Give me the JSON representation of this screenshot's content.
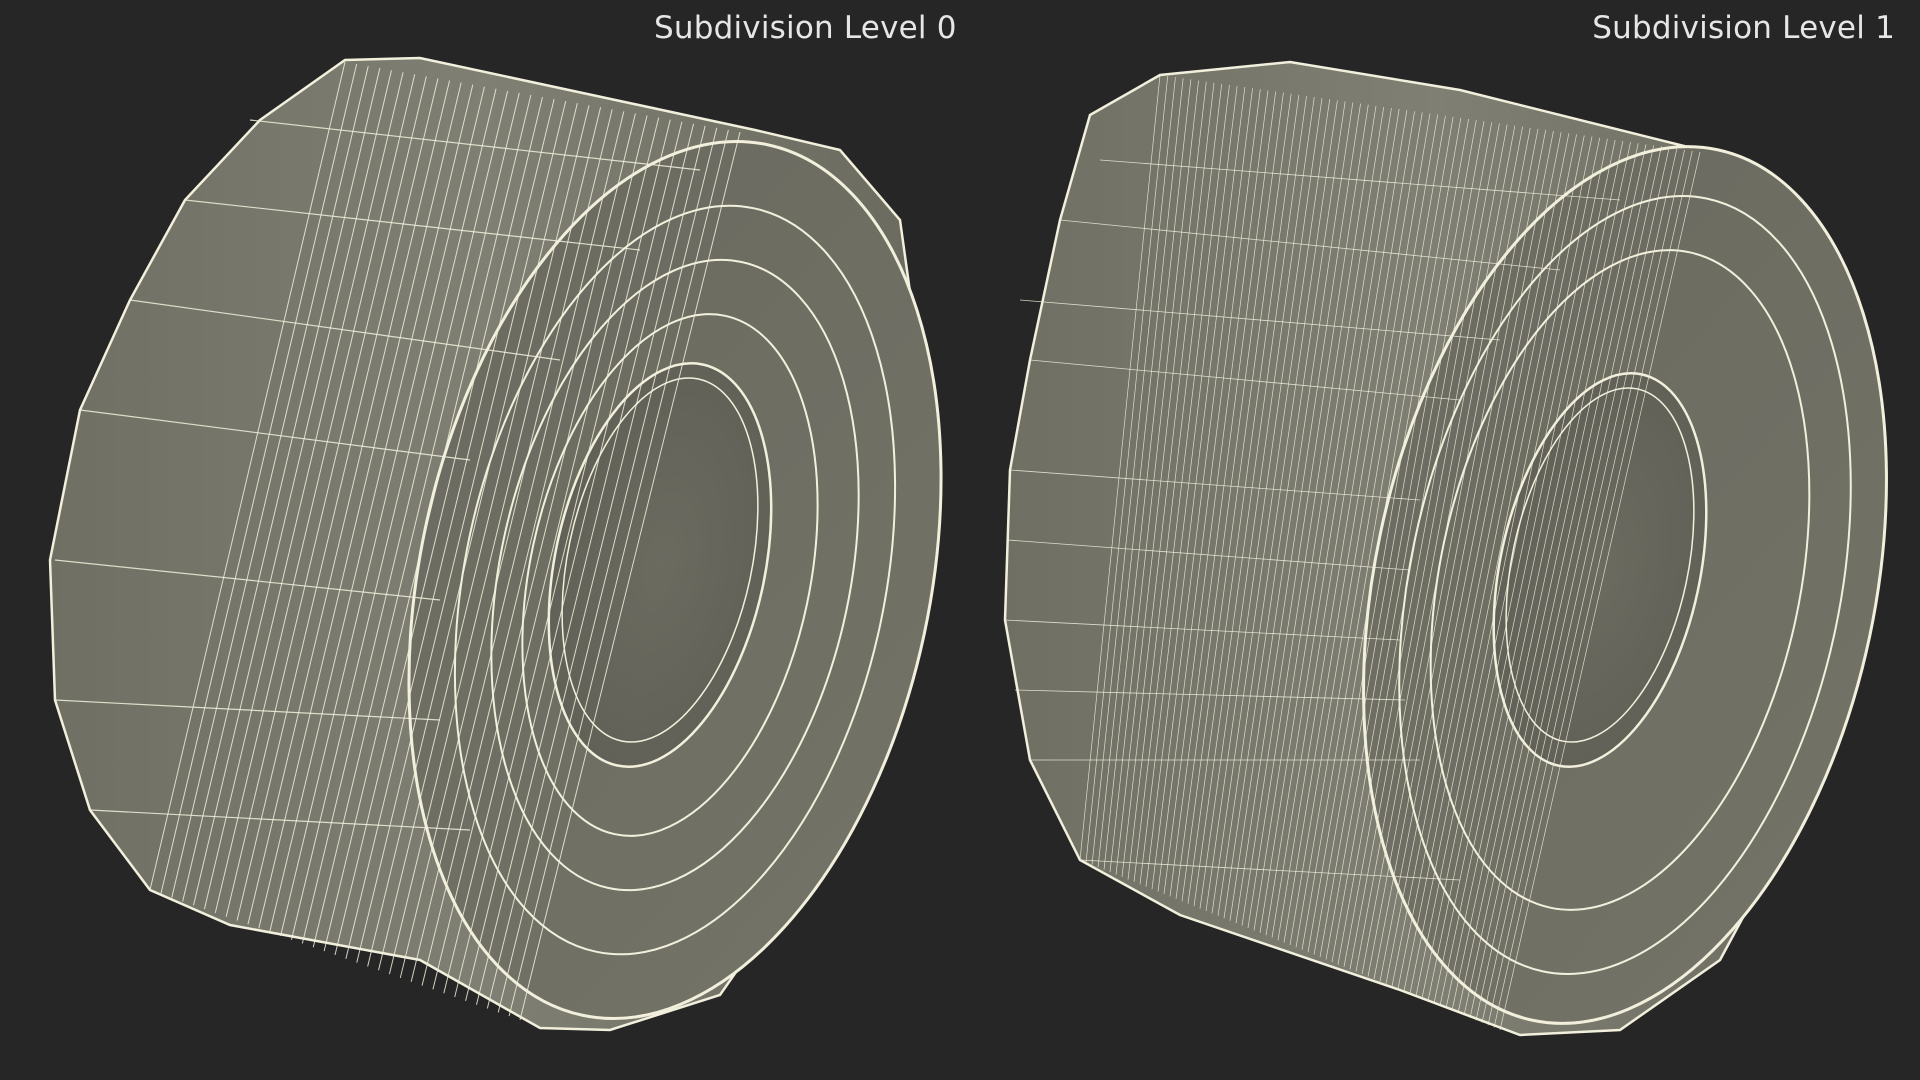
{
  "panels": [
    {
      "label": "Subdivision Level 0"
    },
    {
      "label": "Subdivision Level 1"
    }
  ],
  "colors": {
    "background": "#262626",
    "surface": "#7a7a6e",
    "wireframe": "#f2f0dc",
    "label_text": "#e6e6e6"
  }
}
